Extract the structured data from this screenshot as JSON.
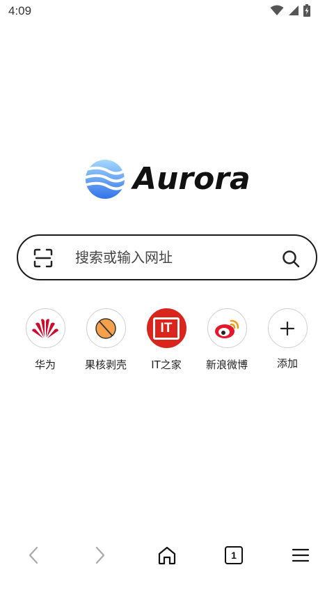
{
  "status_bar": {
    "time": "4:09",
    "icons": [
      "wifi-icon",
      "signal-icon",
      "battery-charging-icon"
    ]
  },
  "logo": {
    "text": "Aurora",
    "icon": "aurora-logo-icon",
    "gradient": [
      "#9bd3ff",
      "#2f7bf0"
    ]
  },
  "search": {
    "placeholder": "搜索或输入网址",
    "left_icon": "scan-icon",
    "right_icon": "search-icon"
  },
  "shortcuts": [
    {
      "label": "华为",
      "icon": "huawei-logo-icon",
      "color": "#cf0a2c"
    },
    {
      "label": "果核剥壳",
      "icon": "guohe-logo-icon",
      "color": "#f5a04a"
    },
    {
      "label": "IT之家",
      "icon": "ithome-logo-icon",
      "color": "#d9251c"
    },
    {
      "label": "新浪微博",
      "icon": "weibo-logo-icon",
      "color": "#e6162d"
    },
    {
      "label": "添加",
      "icon": "plus-icon",
      "color": "#222222"
    }
  ],
  "shortcut_badges": {
    "ithome": "IT"
  },
  "bottom_nav": {
    "back_icon": "chevron-left-icon",
    "forward_icon": "chevron-right-icon",
    "home_icon": "home-icon",
    "tabs_count": "1",
    "menu_icon": "hamburger-menu-icon"
  }
}
